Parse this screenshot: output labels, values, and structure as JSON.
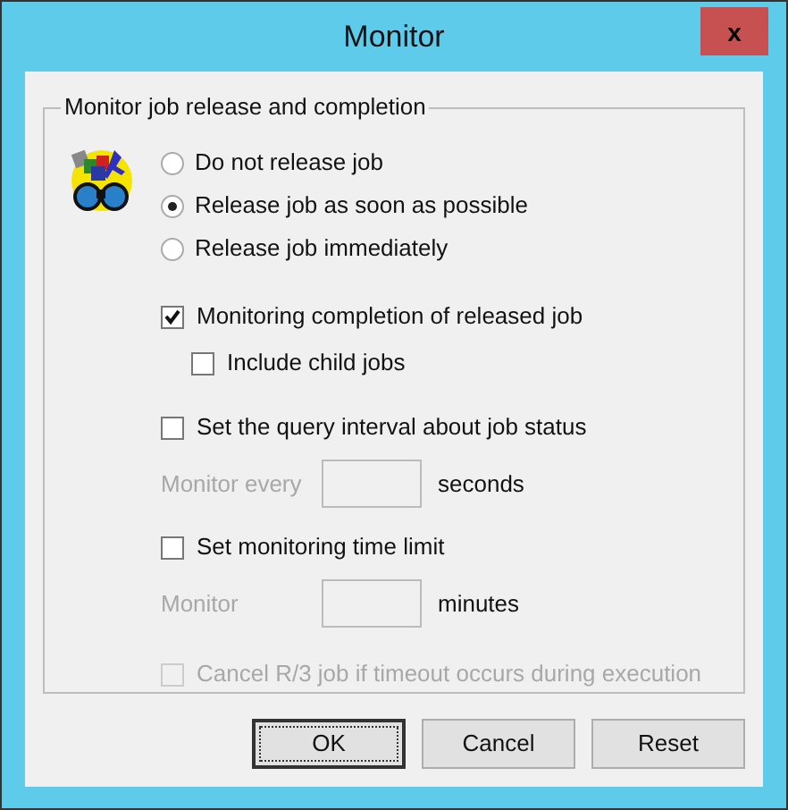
{
  "window": {
    "title": "Monitor",
    "close": "x"
  },
  "group": {
    "label": "Monitor job release and completion"
  },
  "release_options": [
    {
      "label": "Do not release job",
      "selected": false
    },
    {
      "label": "Release job as soon as possible",
      "selected": true
    },
    {
      "label": "Release job immediately",
      "selected": false
    }
  ],
  "monitor_completion": {
    "label": "Monitoring completion of released job",
    "checked": true,
    "disabled": false
  },
  "include_child": {
    "label": "Include child jobs",
    "checked": false,
    "disabled": false
  },
  "query_interval": {
    "label": "Set the query interval about job status",
    "checked": false,
    "disabled": false
  },
  "interval_field": {
    "label": "Monitor every",
    "unit": "seconds",
    "disabled": true
  },
  "time_limit": {
    "label": "Set monitoring time limit",
    "checked": false,
    "disabled": false
  },
  "limit_field": {
    "label": "Monitor",
    "unit": "minutes",
    "disabled": true
  },
  "cancel_on_timeout": {
    "label": "Cancel R/3 job if timeout occurs during execution",
    "checked": false,
    "disabled": true
  },
  "buttons": [
    {
      "label": "OK",
      "focused": true
    },
    {
      "label": "Cancel",
      "focused": false
    },
    {
      "label": "Reset",
      "focused": false
    }
  ]
}
